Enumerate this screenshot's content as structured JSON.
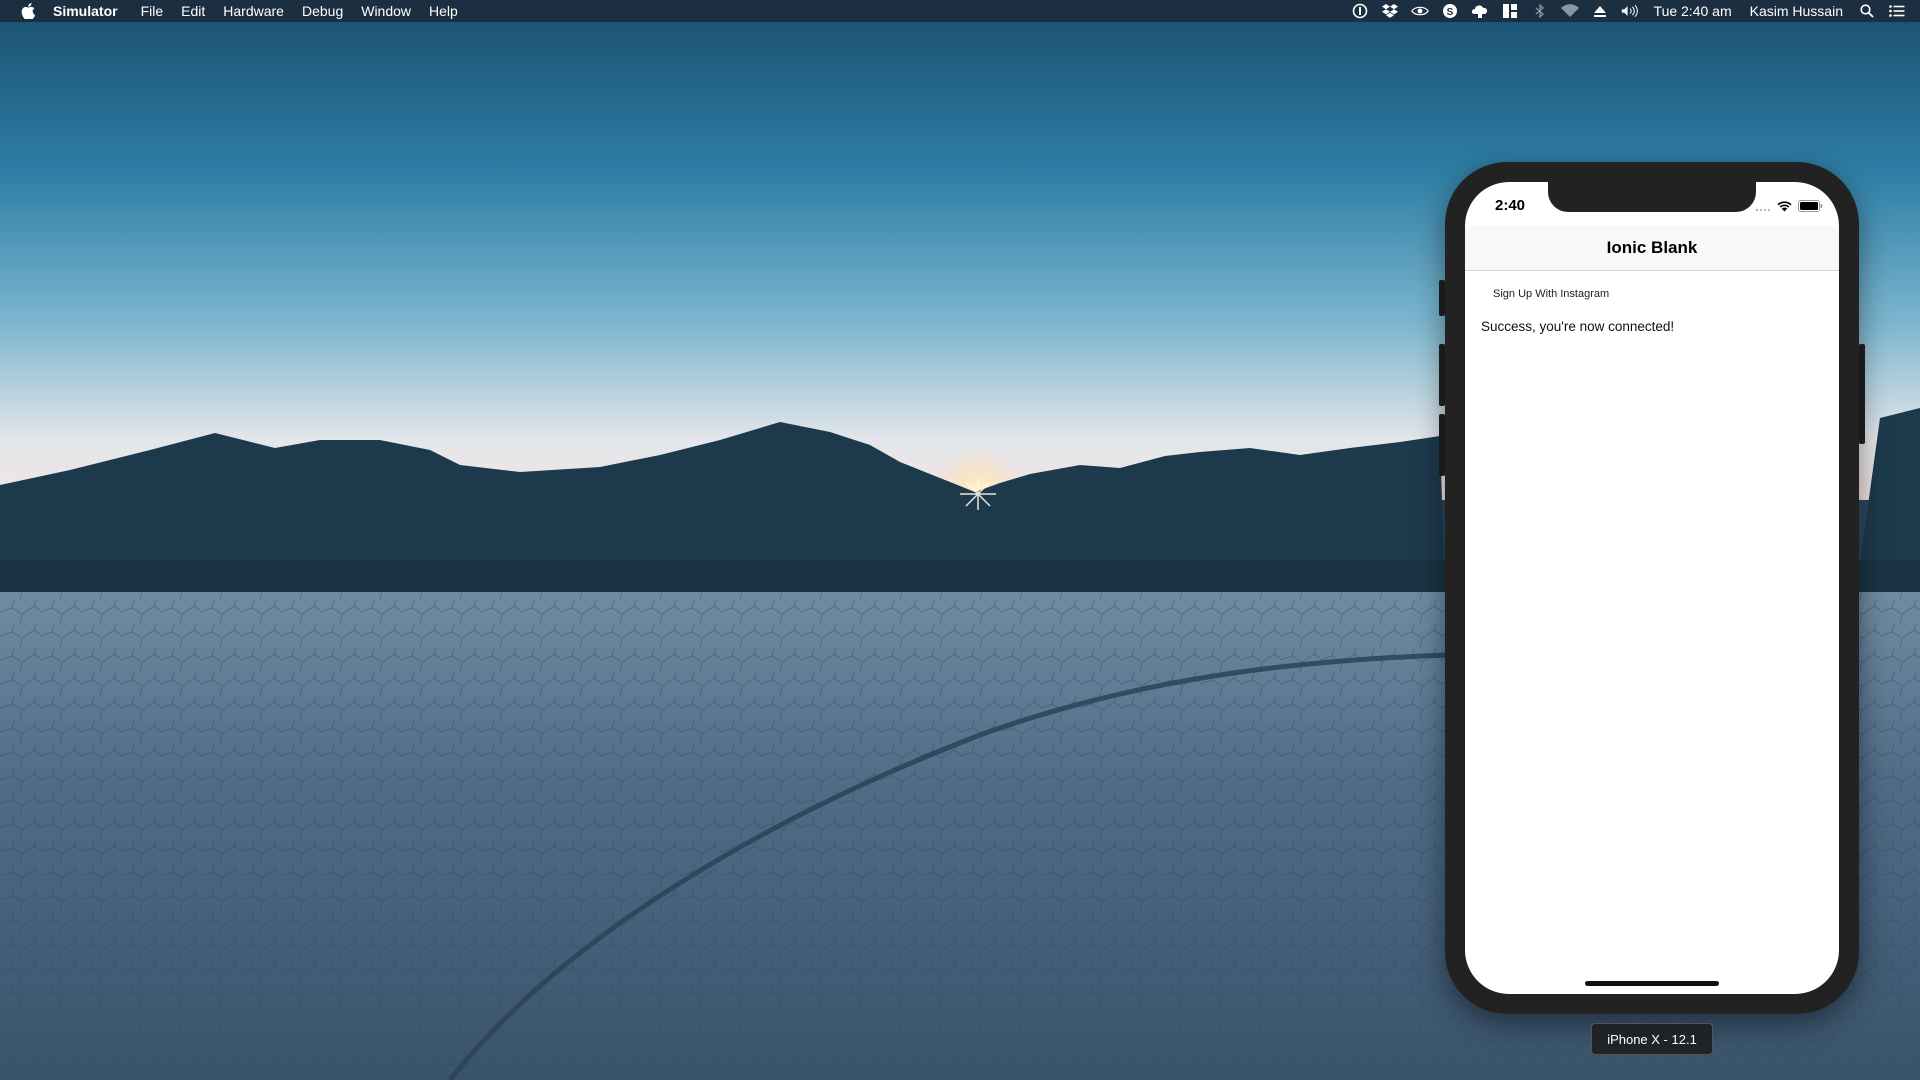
{
  "menubar": {
    "apple_icon": "apple-logo-icon",
    "app_name": "Simulator",
    "menus": [
      "File",
      "Edit",
      "Hardware",
      "Debug",
      "Window",
      "Help"
    ],
    "status_icons": [
      "1password-icon",
      "dropbox-icon",
      "nvidia-icon",
      "skype-icon",
      "creative-cloud-icon",
      "tiling-icon",
      "bluetooth-icon",
      "wifi-icon",
      "eject-icon",
      "volume-icon"
    ],
    "clock": "Tue 2:40 am",
    "user": "Kasim Hussain",
    "right_icons": [
      "spotlight-search-icon",
      "notification-center-icon"
    ]
  },
  "simulator": {
    "status_time": "2:40",
    "nav_title": "Ionic Blank",
    "signup_button": "Sign Up With Instagram",
    "message": "Success, you're now connected!",
    "device_label": "iPhone X - 12.1"
  }
}
